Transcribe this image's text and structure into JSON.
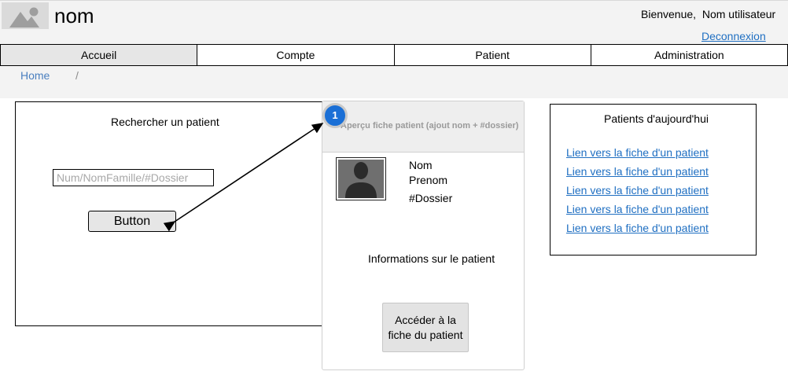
{
  "header": {
    "app_title": "nom",
    "greeting": "Bienvenue,  Nom utilisateur",
    "logout_label": "Deconnexion",
    "logo_icon": "image-placeholder-icon"
  },
  "nav": {
    "tabs": [
      {
        "label": "Accueil"
      },
      {
        "label": "Compte"
      },
      {
        "label": "Patient"
      },
      {
        "label": "Administration"
      }
    ]
  },
  "breadcrumb": {
    "home": "Home",
    "separator": "/"
  },
  "search": {
    "title": "Rechercher un patient",
    "placeholder": "Num/NomFamille/#Dossier",
    "button_label": "Button"
  },
  "preview": {
    "badge": "1",
    "title": "Aperçu fiche patient (ajout nom + #dossier)",
    "avatar_icon": "user-avatar-icon",
    "nom": "Nom",
    "prenom": "Prenom",
    "dossier": "#Dossier",
    "info": "Informations sur le patient",
    "open_button": "Accéder à la fiche du patient"
  },
  "today": {
    "title": "Patients d'aujourd'hui",
    "links": [
      "Lien vers la fiche d'un patient",
      "Lien vers la fiche d'un patient",
      "Lien vers la fiche d'un patient",
      "Lien vers la fiche d'un patient",
      "Lien vers la fiche d'un patient"
    ]
  },
  "colors": {
    "link": "#1f6fc2",
    "badge": "#1a6fd6",
    "header_bg": "#f3f3f3"
  }
}
